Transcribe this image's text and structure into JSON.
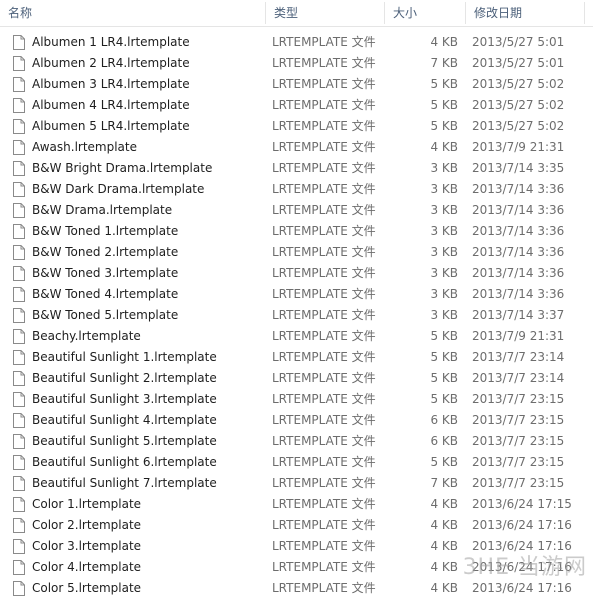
{
  "columns": {
    "name": "名称",
    "type": "类型",
    "size": "大小",
    "modified": "修改日期"
  },
  "files": [
    {
      "name": "Albumen 1 LR4.lrtemplate",
      "type": "LRTEMPLATE 文件",
      "size": "4 KB",
      "date": "2013/5/27 5:01"
    },
    {
      "name": "Albumen 2 LR4.lrtemplate",
      "type": "LRTEMPLATE 文件",
      "size": "7 KB",
      "date": "2013/5/27 5:01"
    },
    {
      "name": "Albumen 3 LR4.lrtemplate",
      "type": "LRTEMPLATE 文件",
      "size": "5 KB",
      "date": "2013/5/27 5:02"
    },
    {
      "name": "Albumen 4 LR4.lrtemplate",
      "type": "LRTEMPLATE 文件",
      "size": "5 KB",
      "date": "2013/5/27 5:02"
    },
    {
      "name": "Albumen 5 LR4.lrtemplate",
      "type": "LRTEMPLATE 文件",
      "size": "5 KB",
      "date": "2013/5/27 5:02"
    },
    {
      "name": "Awash.lrtemplate",
      "type": "LRTEMPLATE 文件",
      "size": "4 KB",
      "date": "2013/7/9 21:31"
    },
    {
      "name": "B&W Bright Drama.lrtemplate",
      "type": "LRTEMPLATE 文件",
      "size": "3 KB",
      "date": "2013/7/14 3:35"
    },
    {
      "name": "B&W Dark Drama.lrtemplate",
      "type": "LRTEMPLATE 文件",
      "size": "3 KB",
      "date": "2013/7/14 3:36"
    },
    {
      "name": "B&W Drama.lrtemplate",
      "type": "LRTEMPLATE 文件",
      "size": "3 KB",
      "date": "2013/7/14 3:36"
    },
    {
      "name": "B&W Toned 1.lrtemplate",
      "type": "LRTEMPLATE 文件",
      "size": "3 KB",
      "date": "2013/7/14 3:36"
    },
    {
      "name": "B&W Toned 2.lrtemplate",
      "type": "LRTEMPLATE 文件",
      "size": "3 KB",
      "date": "2013/7/14 3:36"
    },
    {
      "name": "B&W Toned 3.lrtemplate",
      "type": "LRTEMPLATE 文件",
      "size": "3 KB",
      "date": "2013/7/14 3:36"
    },
    {
      "name": "B&W Toned 4.lrtemplate",
      "type": "LRTEMPLATE 文件",
      "size": "3 KB",
      "date": "2013/7/14 3:36"
    },
    {
      "name": "B&W Toned 5.lrtemplate",
      "type": "LRTEMPLATE 文件",
      "size": "3 KB",
      "date": "2013/7/14 3:37"
    },
    {
      "name": "Beachy.lrtemplate",
      "type": "LRTEMPLATE 文件",
      "size": "5 KB",
      "date": "2013/7/9 21:31"
    },
    {
      "name": "Beautiful Sunlight 1.lrtemplate",
      "type": "LRTEMPLATE 文件",
      "size": "5 KB",
      "date": "2013/7/7 23:14"
    },
    {
      "name": "Beautiful Sunlight 2.lrtemplate",
      "type": "LRTEMPLATE 文件",
      "size": "5 KB",
      "date": "2013/7/7 23:14"
    },
    {
      "name": "Beautiful Sunlight 3.lrtemplate",
      "type": "LRTEMPLATE 文件",
      "size": "5 KB",
      "date": "2013/7/7 23:15"
    },
    {
      "name": "Beautiful Sunlight 4.lrtemplate",
      "type": "LRTEMPLATE 文件",
      "size": "6 KB",
      "date": "2013/7/7 23:15"
    },
    {
      "name": "Beautiful Sunlight 5.lrtemplate",
      "type": "LRTEMPLATE 文件",
      "size": "6 KB",
      "date": "2013/7/7 23:15"
    },
    {
      "name": "Beautiful Sunlight 6.lrtemplate",
      "type": "LRTEMPLATE 文件",
      "size": "5 KB",
      "date": "2013/7/7 23:15"
    },
    {
      "name": "Beautiful Sunlight 7.lrtemplate",
      "type": "LRTEMPLATE 文件",
      "size": "7 KB",
      "date": "2013/7/7 23:15"
    },
    {
      "name": "Color 1.lrtemplate",
      "type": "LRTEMPLATE 文件",
      "size": "4 KB",
      "date": "2013/6/24 17:15"
    },
    {
      "name": "Color 2.lrtemplate",
      "type": "LRTEMPLATE 文件",
      "size": "4 KB",
      "date": "2013/6/24 17:16"
    },
    {
      "name": "Color 3.lrtemplate",
      "type": "LRTEMPLATE 文件",
      "size": "4 KB",
      "date": "2013/6/24 17:16"
    },
    {
      "name": "Color 4.lrtemplate",
      "type": "LRTEMPLATE 文件",
      "size": "4 KB",
      "date": "2013/6/24 17:16"
    },
    {
      "name": "Color 5.lrtemplate",
      "type": "LRTEMPLATE 文件",
      "size": "4 KB",
      "date": "2013/6/24 17:16"
    }
  ],
  "watermark": "3HE 当游网",
  "icons": {
    "file": "file-icon",
    "sort": "sort-arrow-icon"
  }
}
